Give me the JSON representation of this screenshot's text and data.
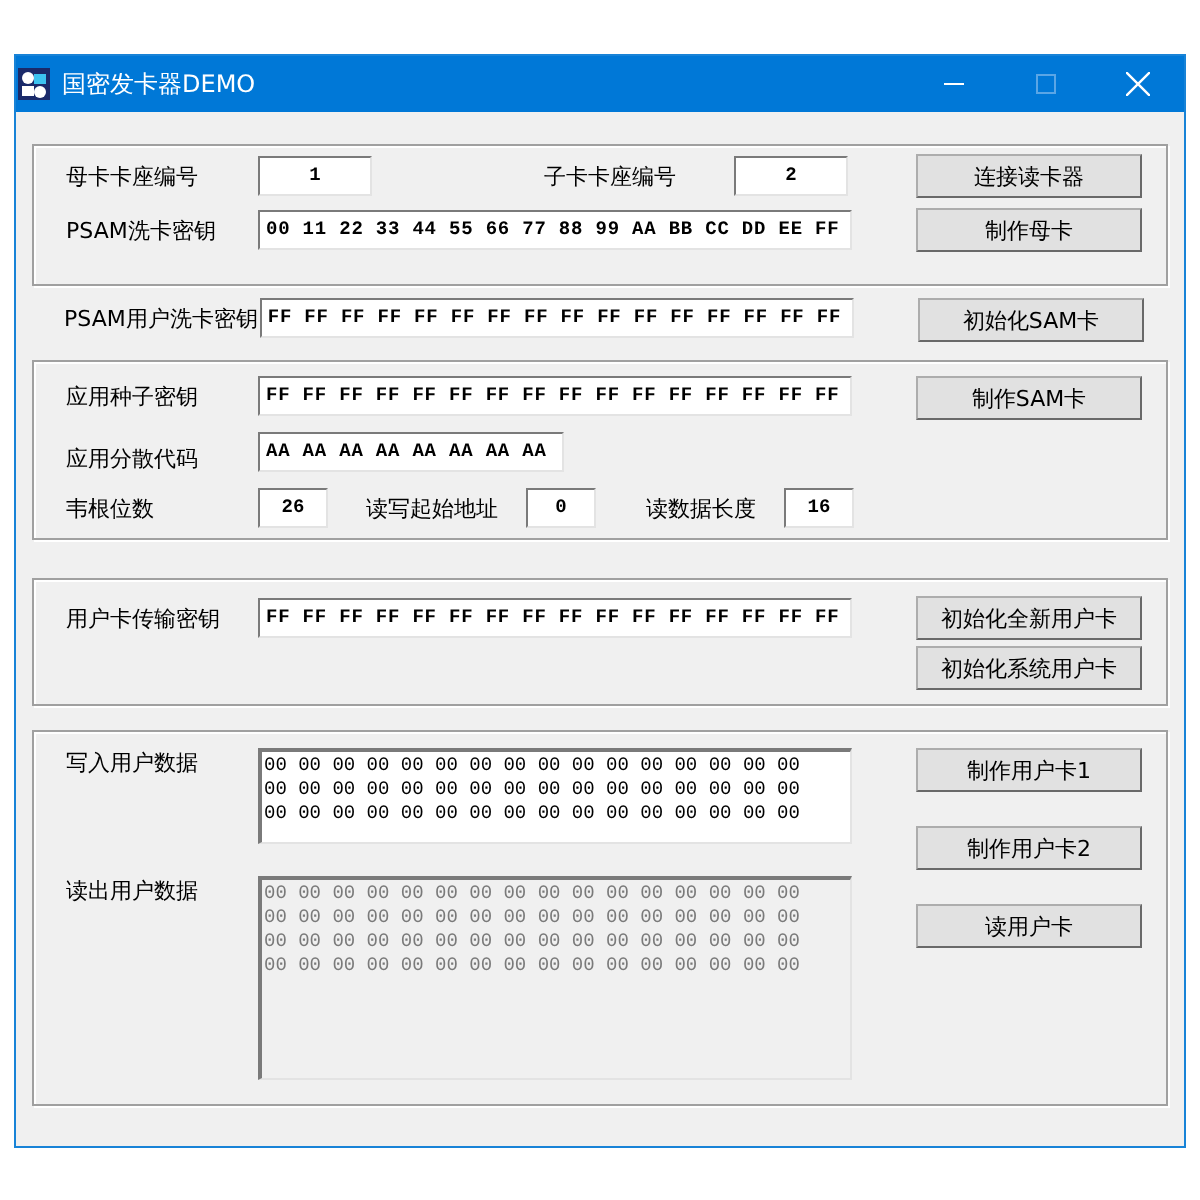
{
  "window": {
    "title": "国密发卡器DEMO",
    "maximize_disabled": true
  },
  "sections": [
    {
      "kind": "keys",
      "rows": [
        {
          "kind": "slots",
          "fields": [
            {
              "label": "母卡卡座编号",
              "value": "1"
            },
            {
              "label": "子卡卡座编号",
              "value": "2"
            }
          ]
        },
        {
          "kind": "key",
          "fields": [
            {
              "label": "PSAM洗卡密钥",
              "value": "00 11 22 33 44 55 66 77 88 99 AA BB CC DD EE FF"
            }
          ]
        }
      ],
      "buttons": [
        "连接读卡器",
        "制作母卡"
      ]
    },
    {
      "kind": "psam",
      "rows": [
        {
          "kind": "key",
          "fields": [
            {
              "label": "PSAM用户洗卡密钥",
              "value": "FF FF FF FF FF FF FF FF FF FF FF FF FF FF FF FF"
            }
          ]
        }
      ],
      "buttons": [
        "初始化SAM卡"
      ]
    },
    {
      "kind": "app",
      "rows": [
        {
          "kind": "key",
          "fields": [
            {
              "label": "应用种子密钥",
              "value": "FF FF FF FF FF FF FF FF FF FF FF FF FF FF FF FF"
            }
          ]
        },
        {
          "kind": "code",
          "fields": [
            {
              "label": "应用分散代码",
              "value": "AA AA AA AA AA AA AA AA"
            }
          ]
        },
        {
          "kind": "params",
          "fields": [
            {
              "label": "韦根位数",
              "value": "26"
            },
            {
              "label": "读写起始地址",
              "value": "0"
            },
            {
              "label": "读数据长度",
              "value": "16"
            }
          ]
        }
      ],
      "buttons": [
        "制作SAM卡"
      ]
    },
    {
      "kind": "transport",
      "rows": [
        {
          "kind": "key",
          "fields": [
            {
              "label": "用户卡传输密钥",
              "value": "FF FF FF FF FF FF FF FF FF FF FF FF FF FF FF FF"
            }
          ]
        }
      ],
      "buttons": [
        "初始化全新用户卡",
        "初始化系统用户卡"
      ]
    },
    {
      "kind": "data",
      "areas": [
        {
          "label": "写入用户数据",
          "readonly": false,
          "lines": [
            "00 00 00 00 00 00 00 00 00 00 00 00 00 00 00 00",
            "00 00 00 00 00 00 00 00 00 00 00 00 00 00 00 00",
            "00 00 00 00 00 00 00 00 00 00 00 00 00 00 00 00"
          ]
        },
        {
          "label": "读出用户数据",
          "readonly": true,
          "lines": [
            "00 00 00 00 00 00 00 00 00 00 00 00 00 00 00 00",
            "00 00 00 00 00 00 00 00 00 00 00 00 00 00 00 00",
            "00 00 00 00 00 00 00 00 00 00 00 00 00 00 00 00",
            "00 00 00 00 00 00 00 00 00 00 00 00 00 00 00 00"
          ]
        }
      ],
      "buttons": [
        "制作用户卡1",
        "制作用户卡2",
        "读用户卡"
      ]
    }
  ]
}
